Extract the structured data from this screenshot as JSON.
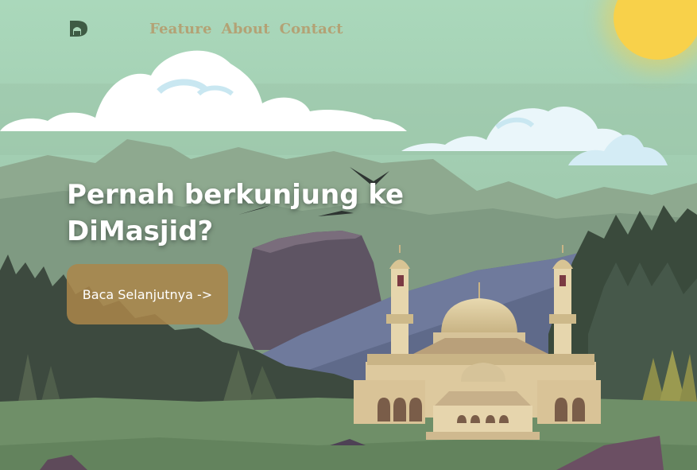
{
  "nav": {
    "logo_icon": "mosque-logo-icon",
    "links": [
      "Feature",
      "About",
      "Contact"
    ]
  },
  "hero": {
    "title": "Pernah berkunjung ke DiMasjid?",
    "cta_label": "Baca Selanjutnya ->"
  },
  "colors": {
    "sky": "#a9d6b8",
    "nav_link": "#b3a275",
    "cta_bg": "#ab864a",
    "sun": "#f8d14a",
    "grass": "#6f8f68"
  }
}
